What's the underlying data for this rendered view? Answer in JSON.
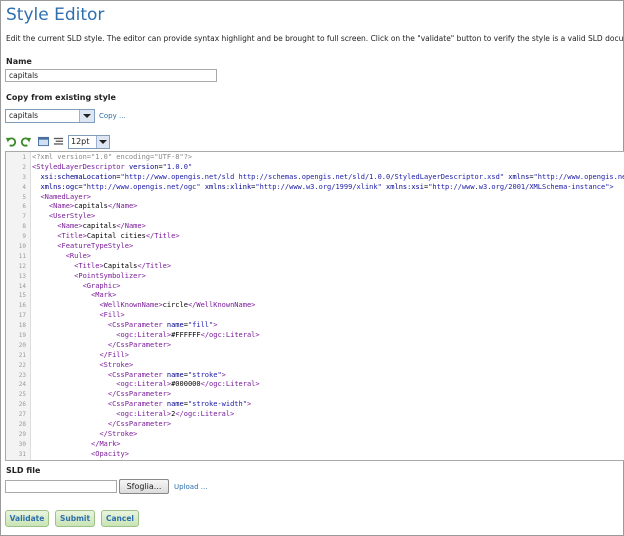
{
  "page": {
    "title": "Style Editor",
    "description": "Edit the current SLD style. The editor can provide syntax highlight and be brought to full screen. Click on the \"validate\" button to verify the style is a valid SLD document."
  },
  "name_field": {
    "label": "Name",
    "value": "capitals"
  },
  "copy_from": {
    "label": "Copy from existing style",
    "selected": "capitals",
    "copy_link": "Copy ..."
  },
  "toolbar": {
    "font_size": "12pt"
  },
  "editor": {
    "lines": [
      {
        "n": "1",
        "parts": [
          {
            "c": "c",
            "s": "<?xml version=\"1.0\" encoding=\"UTF-8\"?>"
          }
        ]
      },
      {
        "n": "2",
        "parts": [
          {
            "c": "t",
            "s": "<StyledLayerDescriptor "
          },
          {
            "c": "a",
            "s": "version"
          },
          {
            "c": "x",
            "s": "="
          },
          {
            "c": "v",
            "s": "\"1.0.0\""
          }
        ]
      },
      {
        "n": "3",
        "parts": [
          {
            "c": "x",
            "s": "  "
          },
          {
            "c": "a",
            "s": "xsi:schemaLocation"
          },
          {
            "c": "x",
            "s": "="
          },
          {
            "c": "v",
            "s": "\"http://www.opengis.net/sld http://schemas.opengis.net/sld/1.0.0/StyledLayerDescriptor.xsd\" "
          },
          {
            "c": "a",
            "s": "xmlns"
          },
          {
            "c": "x",
            "s": "="
          },
          {
            "c": "v",
            "s": "\"http://www.opengis.net/sld\""
          }
        ]
      },
      {
        "n": "4",
        "parts": [
          {
            "c": "x",
            "s": "  "
          },
          {
            "c": "a",
            "s": "xmlns:ogc"
          },
          {
            "c": "x",
            "s": "="
          },
          {
            "c": "v",
            "s": "\"http://www.opengis.net/ogc\" "
          },
          {
            "c": "a",
            "s": "xmlns:xlink"
          },
          {
            "c": "x",
            "s": "="
          },
          {
            "c": "v",
            "s": "\"http://www.w3.org/1999/xlink\" "
          },
          {
            "c": "a",
            "s": "xmlns:xsi"
          },
          {
            "c": "x",
            "s": "="
          },
          {
            "c": "v",
            "s": "\"http://www.w3.org/2001/XMLSchema-instance\">"
          }
        ]
      },
      {
        "n": "5",
        "parts": [
          {
            "c": "x",
            "s": "  "
          },
          {
            "c": "t",
            "s": "<NamedLayer>"
          }
        ]
      },
      {
        "n": "6",
        "parts": [
          {
            "c": "x",
            "s": "    "
          },
          {
            "c": "t",
            "s": "<Name>"
          },
          {
            "c": "x",
            "s": "capitals"
          },
          {
            "c": "t",
            "s": "</Name>"
          }
        ]
      },
      {
        "n": "7",
        "parts": [
          {
            "c": "x",
            "s": "    "
          },
          {
            "c": "t",
            "s": "<UserStyle>"
          }
        ]
      },
      {
        "n": "8",
        "parts": [
          {
            "c": "x",
            "s": "      "
          },
          {
            "c": "t",
            "s": "<Name>"
          },
          {
            "c": "x",
            "s": "capitals"
          },
          {
            "c": "t",
            "s": "</Name>"
          }
        ]
      },
      {
        "n": "9",
        "parts": [
          {
            "c": "x",
            "s": "      "
          },
          {
            "c": "t",
            "s": "<Title>"
          },
          {
            "c": "x",
            "s": "Capital cities"
          },
          {
            "c": "t",
            "s": "</Title>"
          }
        ]
      },
      {
        "n": "10",
        "parts": [
          {
            "c": "x",
            "s": "      "
          },
          {
            "c": "t",
            "s": "<FeatureTypeStyle>"
          }
        ]
      },
      {
        "n": "11",
        "parts": [
          {
            "c": "x",
            "s": "        "
          },
          {
            "c": "t",
            "s": "<Rule>"
          }
        ]
      },
      {
        "n": "12",
        "parts": [
          {
            "c": "x",
            "s": "          "
          },
          {
            "c": "t",
            "s": "<Title>"
          },
          {
            "c": "x",
            "s": "Capitals"
          },
          {
            "c": "t",
            "s": "</Title>"
          }
        ]
      },
      {
        "n": "13",
        "parts": [
          {
            "c": "x",
            "s": "          "
          },
          {
            "c": "t",
            "s": "<PointSymbolizer>"
          }
        ]
      },
      {
        "n": "14",
        "parts": [
          {
            "c": "x",
            "s": "            "
          },
          {
            "c": "t",
            "s": "<Graphic>"
          }
        ]
      },
      {
        "n": "15",
        "parts": [
          {
            "c": "x",
            "s": "              "
          },
          {
            "c": "t",
            "s": "<Mark>"
          }
        ]
      },
      {
        "n": "16",
        "parts": [
          {
            "c": "x",
            "s": "                "
          },
          {
            "c": "t",
            "s": "<WellKnownName>"
          },
          {
            "c": "x",
            "s": "circle"
          },
          {
            "c": "t",
            "s": "</WellKnownName>"
          }
        ]
      },
      {
        "n": "17",
        "parts": [
          {
            "c": "x",
            "s": "                "
          },
          {
            "c": "t",
            "s": "<Fill>"
          }
        ]
      },
      {
        "n": "18",
        "parts": [
          {
            "c": "x",
            "s": "                  "
          },
          {
            "c": "t",
            "s": "<CssParameter "
          },
          {
            "c": "a",
            "s": "name"
          },
          {
            "c": "x",
            "s": "="
          },
          {
            "c": "v",
            "s": "\"fill\""
          },
          {
            "c": "t",
            "s": ">"
          }
        ]
      },
      {
        "n": "19",
        "parts": [
          {
            "c": "x",
            "s": "                    "
          },
          {
            "c": "t",
            "s": "<ogc:Literal>"
          },
          {
            "c": "x",
            "s": "#FFFFFF"
          },
          {
            "c": "t",
            "s": "</ogc:Literal>"
          }
        ]
      },
      {
        "n": "20",
        "parts": [
          {
            "c": "x",
            "s": "                  "
          },
          {
            "c": "t",
            "s": "</CssParameter>"
          }
        ]
      },
      {
        "n": "21",
        "parts": [
          {
            "c": "x",
            "s": "                "
          },
          {
            "c": "t",
            "s": "</Fill>"
          }
        ]
      },
      {
        "n": "22",
        "parts": [
          {
            "c": "x",
            "s": "                "
          },
          {
            "c": "t",
            "s": "<Stroke>"
          }
        ]
      },
      {
        "n": "23",
        "parts": [
          {
            "c": "x",
            "s": "                  "
          },
          {
            "c": "t",
            "s": "<CssParameter "
          },
          {
            "c": "a",
            "s": "name"
          },
          {
            "c": "x",
            "s": "="
          },
          {
            "c": "v",
            "s": "\"stroke\""
          },
          {
            "c": "t",
            "s": ">"
          }
        ]
      },
      {
        "n": "24",
        "parts": [
          {
            "c": "x",
            "s": "                    "
          },
          {
            "c": "t",
            "s": "<ogc:Literal>"
          },
          {
            "c": "x",
            "s": "#000000"
          },
          {
            "c": "t",
            "s": "</ogc:Literal>"
          }
        ]
      },
      {
        "n": "25",
        "parts": [
          {
            "c": "x",
            "s": "                  "
          },
          {
            "c": "t",
            "s": "</CssParameter>"
          }
        ]
      },
      {
        "n": "26",
        "parts": [
          {
            "c": "x",
            "s": "                  "
          },
          {
            "c": "t",
            "s": "<CssParameter "
          },
          {
            "c": "a",
            "s": "name"
          },
          {
            "c": "x",
            "s": "="
          },
          {
            "c": "v",
            "s": "\"stroke-width\""
          },
          {
            "c": "t",
            "s": ">"
          }
        ]
      },
      {
        "n": "27",
        "parts": [
          {
            "c": "x",
            "s": "                    "
          },
          {
            "c": "t",
            "s": "<ogc:Literal>"
          },
          {
            "c": "x",
            "s": "2"
          },
          {
            "c": "t",
            "s": "</ogc:Literal>"
          }
        ]
      },
      {
        "n": "28",
        "parts": [
          {
            "c": "x",
            "s": "                  "
          },
          {
            "c": "t",
            "s": "</CssParameter>"
          }
        ]
      },
      {
        "n": "29",
        "parts": [
          {
            "c": "x",
            "s": "                "
          },
          {
            "c": "t",
            "s": "</Stroke>"
          }
        ]
      },
      {
        "n": "30",
        "parts": [
          {
            "c": "x",
            "s": "              "
          },
          {
            "c": "t",
            "s": "</Mark>"
          }
        ]
      },
      {
        "n": "31",
        "parts": [
          {
            "c": "x",
            "s": "              "
          },
          {
            "c": "t",
            "s": "<Opacity>"
          }
        ]
      }
    ]
  },
  "sld_file": {
    "label": "SLD file",
    "browse_label": "Sfoglia...",
    "upload_link": "Upload ..."
  },
  "buttons": {
    "validate": "Validate",
    "submit": "Submit",
    "cancel": "Cancel"
  },
  "colors": {
    "accent": "#2f6fb0",
    "button_bg": "#d6ecc4",
    "tag": "#7a1a9a",
    "attr_value": "#1a1aa6"
  }
}
